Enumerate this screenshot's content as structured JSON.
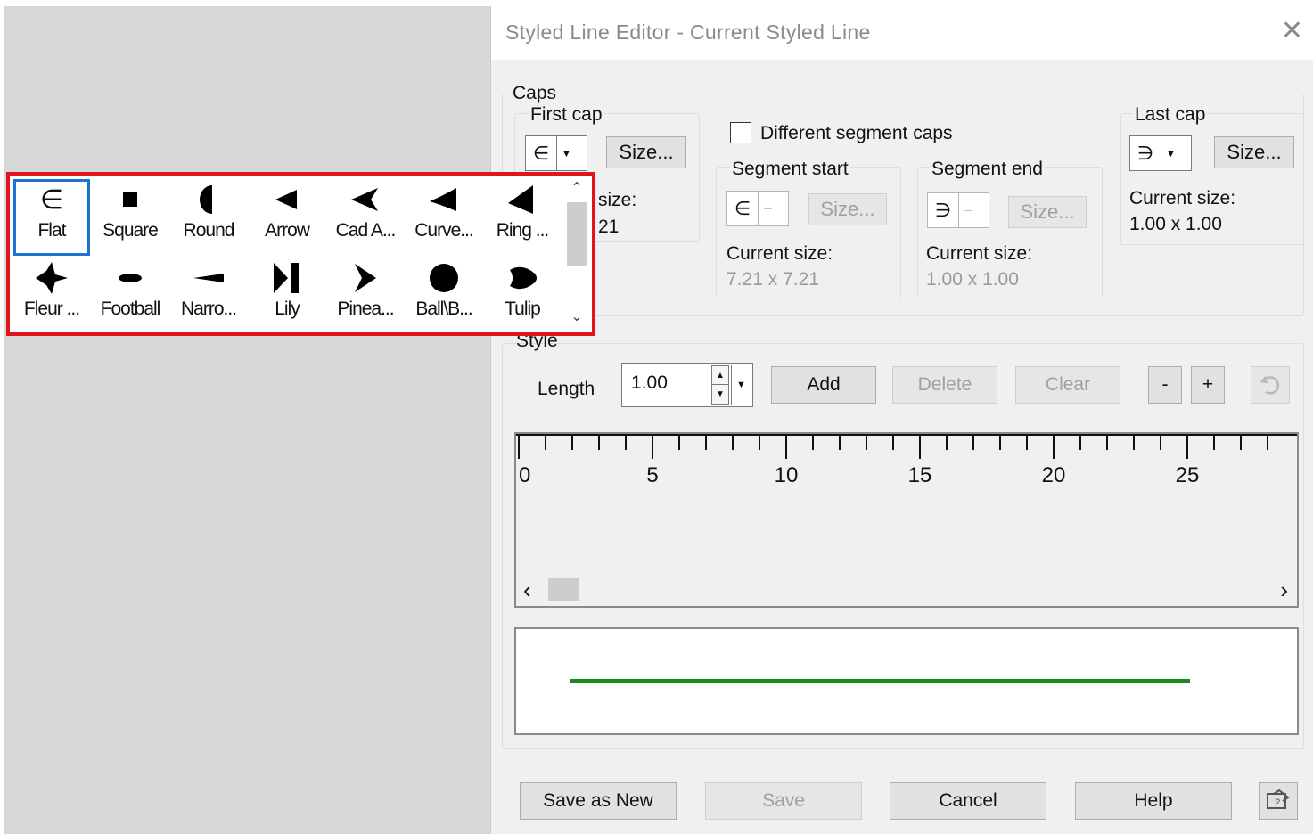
{
  "window": {
    "title": "Styled Line Editor -  Current Styled Line",
    "close_glyph": "✕"
  },
  "caps": {
    "label": "Caps",
    "first_cap": {
      "label": "First cap",
      "glyph": "∈",
      "size_button": "Size...",
      "partial_size_label": "size:",
      "partial_size_value": "21"
    },
    "different_segment_caps": {
      "label": "Different segment caps",
      "checked": false
    },
    "segment_start": {
      "label": "Segment start",
      "glyph": "∈",
      "size_button": "Size...",
      "current_size_label": "Current size:",
      "current_size_value": "7.21 x 7.21"
    },
    "segment_end": {
      "label": "Segment end",
      "glyph": "∋",
      "size_button": "Size...",
      "current_size_label": "Current size:",
      "current_size_value": "1.00 x 1.00"
    },
    "last_cap": {
      "label": "Last cap",
      "glyph": "∋",
      "size_button": "Size...",
      "current_size_label": "Current size:",
      "current_size_value": "1.00 x 1.00"
    }
  },
  "style": {
    "label": "Style",
    "length_label": "Length",
    "length_value": "1.00",
    "add_button": "Add",
    "delete_button": "Delete",
    "clear_button": "Clear",
    "minus_button": "-",
    "plus_button": "+",
    "reset_icon": "reset-icon"
  },
  "ruler": {
    "labels": [
      "0",
      "5",
      "10",
      "15",
      "20",
      "25"
    ],
    "scroll_left": "‹",
    "scroll_right": "›"
  },
  "preview": {
    "line_color": "#1a8a1a"
  },
  "footer": {
    "save_as_new": "Save as New",
    "save": "Save",
    "cancel": "Cancel",
    "help": "Help"
  },
  "cap_picker": {
    "highlight_color": "#e0151b",
    "selection_color": "#1c73d1",
    "items": [
      {
        "name": "Flat",
        "icon": "flat-cap-icon"
      },
      {
        "name": "Square",
        "icon": "square-cap-icon"
      },
      {
        "name": "Round",
        "icon": "round-cap-icon"
      },
      {
        "name": "Arrow",
        "icon": "arrow-cap-icon"
      },
      {
        "name": "Cad A...",
        "icon": "cad-arrow-cap-icon"
      },
      {
        "name": "Curve...",
        "icon": "curved-arrow-cap-icon"
      },
      {
        "name": "Ring ...",
        "icon": "ring-cap-icon"
      },
      {
        "name": "Fleur ...",
        "icon": "fleur-cap-icon"
      },
      {
        "name": "Football",
        "icon": "football-cap-icon"
      },
      {
        "name": "Narro...",
        "icon": "narrow-cap-icon"
      },
      {
        "name": "Lily",
        "icon": "lily-cap-icon"
      },
      {
        "name": "Pinea...",
        "icon": "pineapple-cap-icon"
      },
      {
        "name": "Ball\\B...",
        "icon": "ball-cap-icon"
      },
      {
        "name": "Tulip",
        "icon": "tulip-cap-icon"
      }
    ],
    "selected_index": 0
  }
}
